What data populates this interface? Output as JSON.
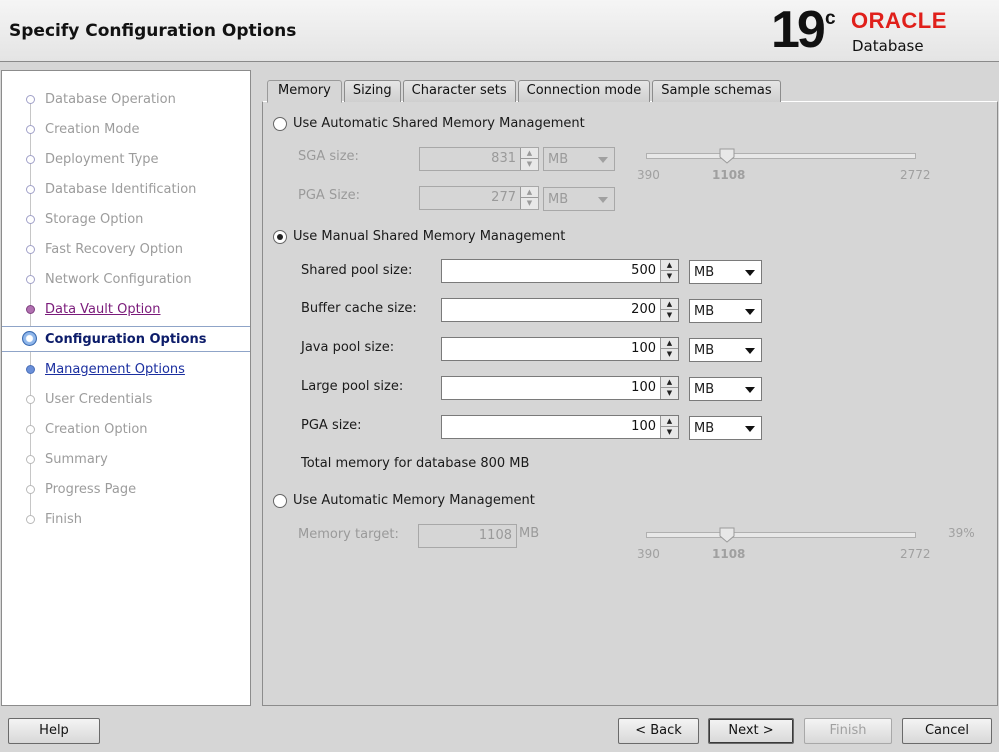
{
  "header": {
    "title": "Specify Configuration Options",
    "logo_version": "19",
    "logo_sup": "c",
    "logo_brand": "ORACLE",
    "logo_product": "Database",
    "brand_color": "#e0201b"
  },
  "nav": {
    "items": [
      {
        "label": "Database Operation",
        "state": "done"
      },
      {
        "label": "Creation Mode",
        "state": "done"
      },
      {
        "label": "Deployment Type",
        "state": "done"
      },
      {
        "label": "Database Identification",
        "state": "done"
      },
      {
        "label": "Storage Option",
        "state": "done"
      },
      {
        "label": "Fast Recovery Option",
        "state": "done"
      },
      {
        "label": "Network Configuration",
        "state": "done"
      },
      {
        "label": "Data Vault Option",
        "state": "visited"
      },
      {
        "label": "Configuration Options",
        "state": "current"
      },
      {
        "label": "Management Options",
        "state": "link"
      },
      {
        "label": "User Credentials",
        "state": "todo"
      },
      {
        "label": "Creation Option",
        "state": "todo"
      },
      {
        "label": "Summary",
        "state": "todo"
      },
      {
        "label": "Progress Page",
        "state": "todo"
      },
      {
        "label": "Finish",
        "state": "todo"
      }
    ]
  },
  "tabs": [
    {
      "label": "Memory",
      "active": true
    },
    {
      "label": "Sizing",
      "active": false
    },
    {
      "label": "Character sets",
      "active": false
    },
    {
      "label": "Connection mode",
      "active": false
    },
    {
      "label": "Sample schemas",
      "active": false
    }
  ],
  "memory": {
    "asmm": {
      "label": "Use Automatic Shared Memory Management",
      "selected": false,
      "sga_label": "SGA size:",
      "sga_value": "831",
      "sga_unit": "MB",
      "pga_label": "PGA Size:",
      "pga_value": "277",
      "pga_unit": "MB",
      "slider": {
        "min": "390",
        "current": "1108",
        "max": "2772",
        "fraction": 0.3
      }
    },
    "manual": {
      "label": "Use Manual Shared Memory Management",
      "selected": true,
      "shared_pool_label": "Shared pool size:",
      "shared_pool_value": "500",
      "shared_pool_unit": "MB",
      "buffer_cache_label": "Buffer cache size:",
      "buffer_cache_value": "200",
      "buffer_cache_unit": "MB",
      "java_pool_label": "Java pool size:",
      "java_pool_value": "100",
      "java_pool_unit": "MB",
      "large_pool_label": "Large pool size:",
      "large_pool_value": "100",
      "large_pool_unit": "MB",
      "pga_label": "PGA size:",
      "pga_value": "100",
      "pga_unit": "MB",
      "total": "Total memory for database 800 MB"
    },
    "amm": {
      "label": "Use Automatic Memory Management",
      "selected": false,
      "target_label": "Memory target:",
      "target_value": "1108",
      "target_unit": "MB",
      "percent": "39%",
      "slider": {
        "min": "390",
        "current": "1108",
        "max": "2772",
        "fraction": 0.3
      }
    }
  },
  "buttons": {
    "help": "Help",
    "back": "< Back",
    "next": "Next >",
    "finish": "Finish",
    "cancel": "Cancel"
  }
}
